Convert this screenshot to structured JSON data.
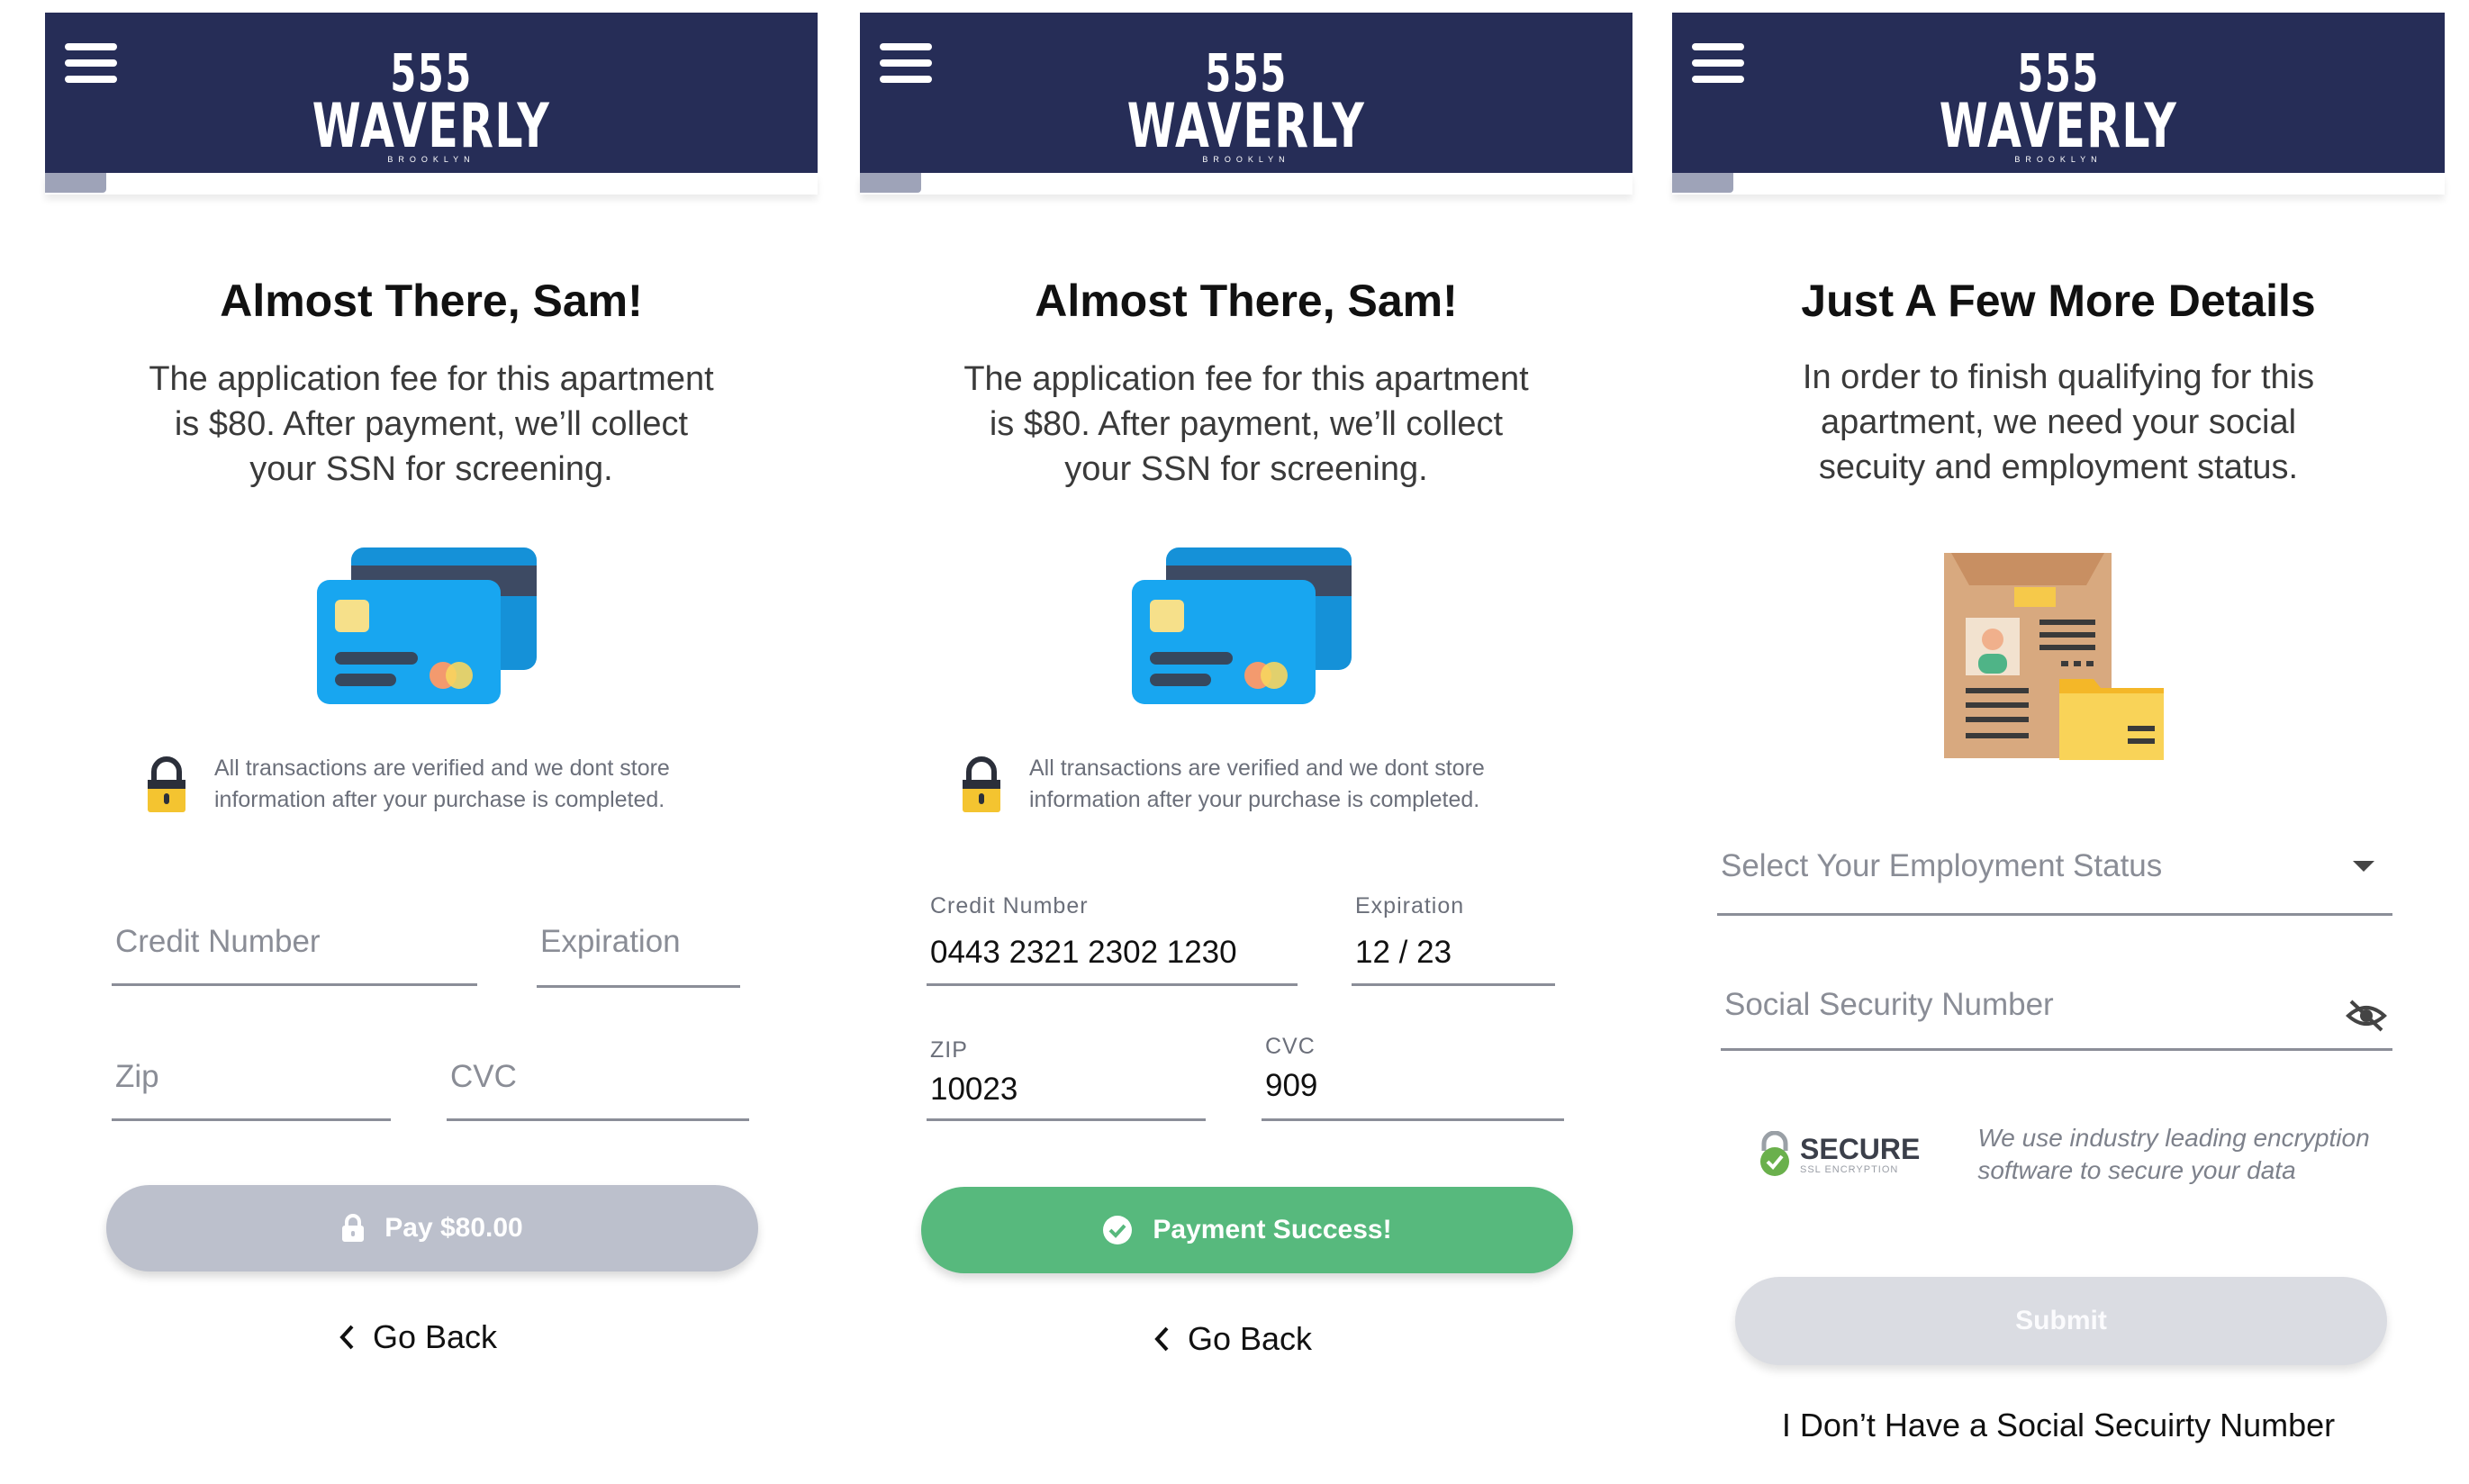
{
  "brand": {
    "number": "555",
    "name": "WAVERLY",
    "sub": "BROOKLYN"
  },
  "colors": {
    "header": "#262d57",
    "success": "#57b97d",
    "disabled": "#bcc0cc",
    "card_blue": "#18a6f0"
  },
  "screens": [
    {
      "title": "Almost There, Sam!",
      "desc": [
        "The application fee for this apartment",
        "is $80. After payment, we’ll collect",
        "your SSN for screening."
      ],
      "secure_note": [
        "All transactions are verified and we dont store",
        "information after your purchase is completed."
      ],
      "fields": {
        "credit": {
          "placeholder": "Credit Number"
        },
        "expiration": {
          "placeholder": "Expiration"
        },
        "zip": {
          "placeholder": "Zip"
        },
        "cvc": {
          "placeholder": "CVC"
        }
      },
      "button": {
        "label": "Pay $80.00",
        "icon": "lock-icon",
        "state": "disabled"
      },
      "go_back": "Go Back"
    },
    {
      "title": "Almost There, Sam!",
      "desc": [
        "The application fee for this apartment",
        "is $80. After payment, we’ll collect",
        "your SSN for screening."
      ],
      "secure_note": [
        "All transactions are verified and we dont store",
        "information after your purchase is completed."
      ],
      "fields": {
        "credit": {
          "label": "Credit Number",
          "value": "0443 2321 2302 1230"
        },
        "expiration": {
          "label": "Expiration",
          "value": "12 / 23"
        },
        "zip": {
          "label": "ZIP",
          "value": "10023"
        },
        "cvc": {
          "label": "CVC",
          "value": "909"
        }
      },
      "button": {
        "label": "Payment Success!",
        "icon": "check-circle-icon",
        "state": "success"
      },
      "go_back": "Go Back"
    },
    {
      "title": "Just A Few More Details",
      "desc": [
        "In order to finish qualifying for this",
        "apartment, we need your social",
        "secuity and employment status."
      ],
      "fields": {
        "employment": {
          "placeholder": "Select Your Employment Status"
        },
        "ssn": {
          "placeholder": "Social Security Number"
        }
      },
      "ssl": {
        "badge": "SECURE",
        "badge_sub": "SSL ENCRYPTION",
        "text": [
          "We use industry leading encryption",
          "software to secure your data"
        ]
      },
      "button": {
        "label": "Submit",
        "state": "disabled"
      },
      "no_ssn_link": "I Don’t Have a Social Secuirty Number"
    }
  ]
}
